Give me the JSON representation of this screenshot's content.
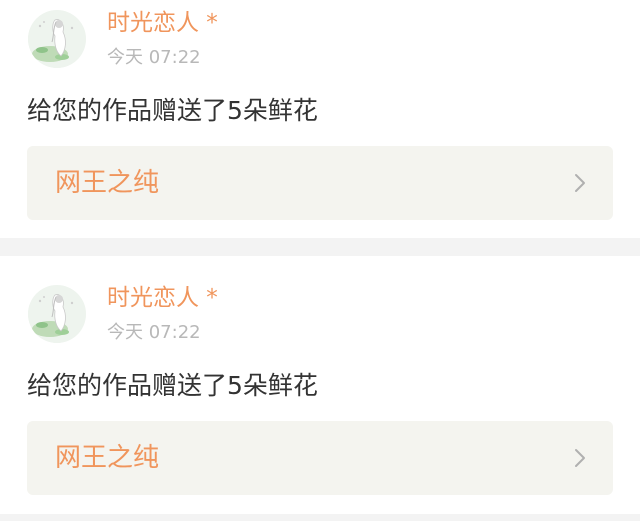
{
  "notifications": [
    {
      "user": "时光恋人 *",
      "time": "今天 07:22",
      "message": "给您的作品赠送了5朵鲜花",
      "work_title": "网王之纯",
      "avatar_icon": "avatar-illustration",
      "chevron_icon": "chevron-right-icon"
    },
    {
      "user": "时光恋人 *",
      "time": "今天 07:22",
      "message": "给您的作品赠送了5朵鲜花",
      "work_title": "网王之纯",
      "avatar_icon": "avatar-illustration",
      "chevron_icon": "chevron-right-icon"
    }
  ],
  "colors": {
    "accent": "#f0955c",
    "background": "#f3f3f3",
    "card": "#ffffff",
    "link_box": "#f4f4ef",
    "time": "#b8b8b8",
    "text": "#333333"
  }
}
